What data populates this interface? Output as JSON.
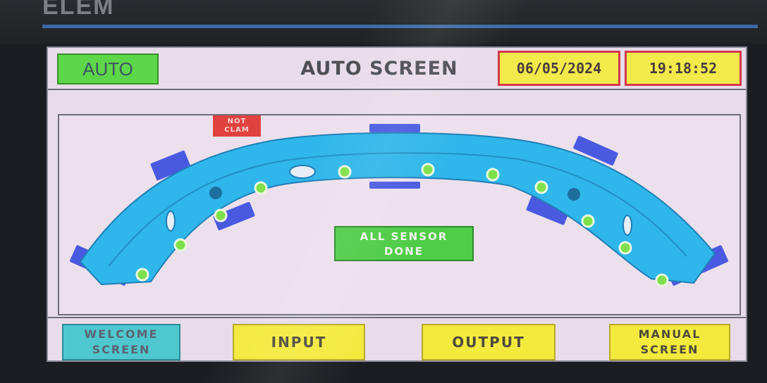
{
  "brand": {
    "text": "ELEM"
  },
  "header": {
    "mode_badge": "AUTO",
    "title": "AUTO SCREEN",
    "date": "06/05/2024",
    "time": "19:18:52"
  },
  "part_view": {
    "clamp_status_line1": "NOT",
    "clamp_status_line2": "CLAM",
    "sensor_status_line1": "ALL SENSOR",
    "sensor_status_line2": "DONE",
    "sensor_ok_color": "#7ee04a",
    "part_color": "#2fb6ea",
    "clamp_color": "#4a5ae0",
    "sensor_count": 13
  },
  "footer": {
    "welcome_line1": "WELCOME",
    "welcome_line2": "SCREEN",
    "input": "INPUT",
    "output": "OUTPUT",
    "manual_line1": "MANUAL",
    "manual_line2": "SCREEN"
  }
}
